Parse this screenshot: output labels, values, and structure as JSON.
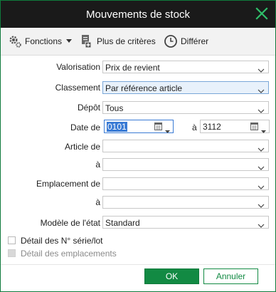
{
  "window": {
    "title": "Mouvements de stock"
  },
  "toolbar": {
    "functions_label": "Fonctions",
    "more_criteria_label": "Plus de critères",
    "defer_label": "Différer"
  },
  "form": {
    "valorisation": {
      "label": "Valorisation",
      "value": "Prix de revient"
    },
    "classement": {
      "label": "Classement",
      "value": "Par référence article"
    },
    "depot": {
      "label": "Dépôt",
      "value": "Tous"
    },
    "date": {
      "label": "Date de",
      "from": "0101",
      "to_label": "à",
      "to": "3112"
    },
    "article": {
      "label": "Article de",
      "from": "",
      "to_label": "à",
      "to": ""
    },
    "emplacement": {
      "label": "Emplacement de",
      "from": "",
      "to_label": "à",
      "to": ""
    },
    "modele": {
      "label": "Modèle de l'état",
      "value": "Standard"
    }
  },
  "checkboxes": {
    "detail_serie": {
      "label": "Détail des N° série/lot",
      "checked": false
    },
    "detail_emplacements": {
      "label": "Détail des emplacements",
      "checked": false,
      "disabled": true
    }
  },
  "buttons": {
    "ok": "OK",
    "cancel": "Annuler"
  },
  "colors": {
    "accent": "#128a43",
    "titlebar": "#1a1a1a",
    "focus": "#3a7bd5"
  }
}
